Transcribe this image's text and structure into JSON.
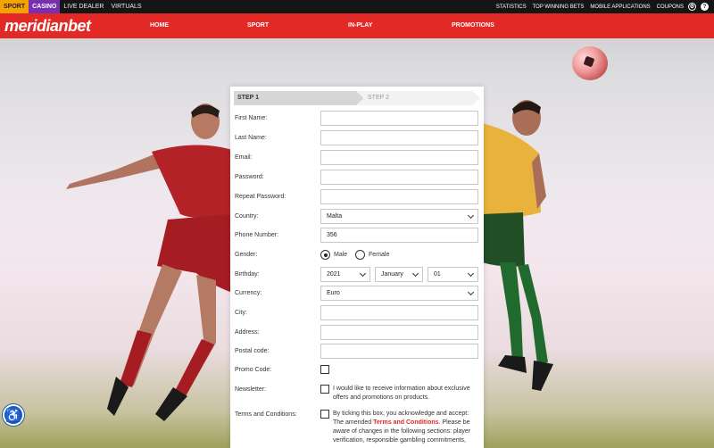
{
  "topbar": {
    "tabs": [
      "SPORT",
      "CASINO",
      "LIVE DEALER",
      "VIRTUALS"
    ],
    "links": [
      "STATISTICS",
      "TOP WINNING BETS",
      "MOBILE APPLICATIONS",
      "COUPONS"
    ]
  },
  "header": {
    "logo": "meridianbet",
    "nav": [
      "HOME",
      "SPORT",
      "IN-PLAY",
      "PROMOTIONS"
    ]
  },
  "colors": {
    "brand_red": "#e22926",
    "sport_tab": "#f4a400",
    "casino_tab": "#7a2fb0",
    "topbar_bg": "#151515"
  },
  "steps": {
    "step1": "STEP 1",
    "step2": "STEP 2"
  },
  "form": {
    "first_name": {
      "label": "First Name:",
      "value": ""
    },
    "last_name": {
      "label": "Last Name:",
      "value": ""
    },
    "email": {
      "label": "Email:",
      "value": ""
    },
    "password": {
      "label": "Password:",
      "value": ""
    },
    "repeat_password": {
      "label": "Repeat Password:",
      "value": ""
    },
    "country": {
      "label": "Country:",
      "value": "Malta"
    },
    "phone": {
      "label": "Phone Number:",
      "value": "356"
    },
    "gender": {
      "label": "Gender:",
      "options": [
        "Male",
        "Female"
      ],
      "selected": "Male"
    },
    "birthday": {
      "label": "Birthday:",
      "year": "2021",
      "month": "January",
      "day": "01"
    },
    "currency": {
      "label": "Currency:",
      "value": "Euro"
    },
    "city": {
      "label": "City:",
      "value": ""
    },
    "address": {
      "label": "Address:",
      "value": ""
    },
    "postal_code": {
      "label": "Postal code:",
      "value": ""
    },
    "promo_code": {
      "label": "Promo Code:"
    },
    "newsletter": {
      "label": "Newsletter:",
      "text": "I would like to receive information about exclusive offers and promotions on products."
    },
    "terms": {
      "label": "Terms and Conditions:",
      "text_before": "By ticking this box, you acknowledge and accept: The amended ",
      "link": "Terms and Conditions",
      "text_after": ". Please be aware of changes in the following sections: player verification, responsible gambling commitments,"
    }
  },
  "icons": {
    "settings": "gear-icon",
    "help": "help-icon",
    "accessibility": "accessibility-icon"
  }
}
